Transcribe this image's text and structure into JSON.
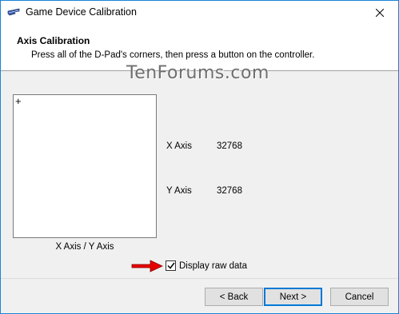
{
  "window": {
    "title": "Game Device Calibration"
  },
  "header": {
    "title": "Axis Calibration",
    "subtitle": "Press all of the D-Pad's corners, then press a button on the controller."
  },
  "watermark": "TenForums.com",
  "plot": {
    "crosshair": "+",
    "label": "X Axis / Y Axis"
  },
  "axes": [
    {
      "label": "X Axis",
      "value": "32768"
    },
    {
      "label": "Y Axis",
      "value": "32768"
    }
  ],
  "raw_data": {
    "label": "Display raw data",
    "checked": true
  },
  "buttons": {
    "back": "< Back",
    "next": "Next >",
    "cancel": "Cancel"
  },
  "colors": {
    "accent": "#0078d7",
    "annotation_arrow": "#e60000",
    "window_border": "#1883d7"
  },
  "icons": {
    "title": "game-controller-icon",
    "close": "close-icon",
    "check": "checkmark-icon",
    "annotation": "arrow-right-icon"
  }
}
